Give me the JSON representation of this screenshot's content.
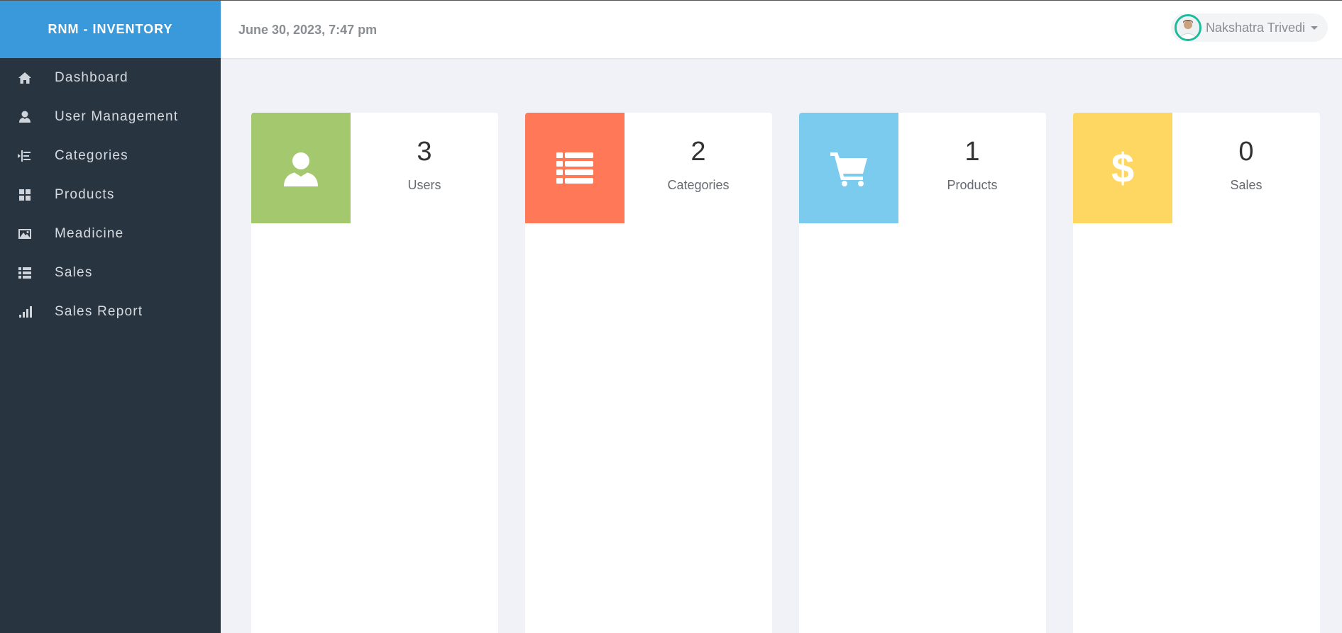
{
  "brand": "RNM - INVENTORY",
  "header": {
    "datetime": "June 30, 2023, 7:47 pm",
    "user_name": "Nakshatra Trivedi",
    "avatar_color": "#1abc9c"
  },
  "sidebar": {
    "items": [
      {
        "label": "Dashboard",
        "icon": "home-icon"
      },
      {
        "label": "User Management",
        "icon": "user-icon"
      },
      {
        "label": "Categories",
        "icon": "indent-icon"
      },
      {
        "label": "Products",
        "icon": "grid-icon"
      },
      {
        "label": "Meadicine",
        "icon": "picture-icon"
      },
      {
        "label": "Sales",
        "icon": "list-icon"
      },
      {
        "label": "Sales Report",
        "icon": "signal-icon"
      }
    ]
  },
  "stats": [
    {
      "count": "3",
      "label": "Users",
      "color": "#a3c86d",
      "icon": "user-icon"
    },
    {
      "count": "2",
      "label": "Categories",
      "color": "#ff7857",
      "icon": "list-icon"
    },
    {
      "count": "1",
      "label": "Products",
      "color": "#7acbee",
      "icon": "shopping-cart-icon"
    },
    {
      "count": "0",
      "label": "Sales",
      "color": "#fdd762",
      "icon": "dollar-icon"
    }
  ]
}
